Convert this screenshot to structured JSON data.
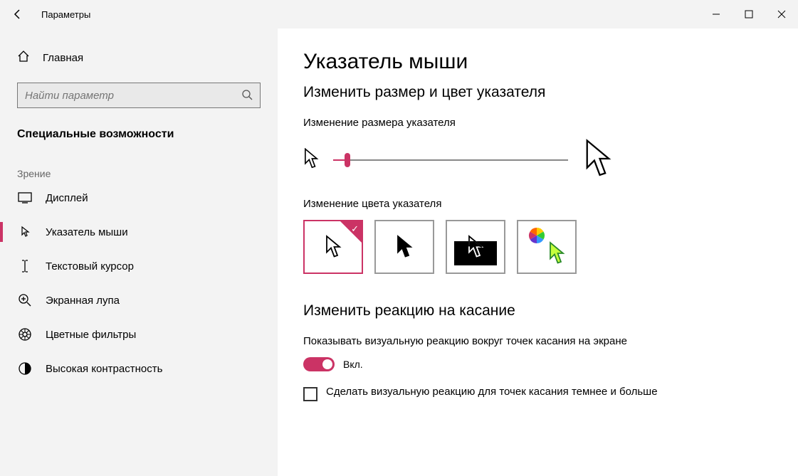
{
  "titlebar": {
    "title": "Параметры"
  },
  "sidebar": {
    "home": "Главная",
    "search_placeholder": "Найти параметр",
    "category": "Специальные возможности",
    "group_vision": "Зрение",
    "items": [
      {
        "icon": "display-icon",
        "label": "Дисплей"
      },
      {
        "icon": "pointer-icon",
        "label": "Указатель мыши",
        "active": true
      },
      {
        "icon": "text-cursor-icon",
        "label": "Текстовый курсор"
      },
      {
        "icon": "magnifier-icon",
        "label": "Экранная лупа"
      },
      {
        "icon": "color-filters-icon",
        "label": "Цветные фильтры"
      },
      {
        "icon": "contrast-icon",
        "label": "Высокая контрастность"
      }
    ]
  },
  "main": {
    "title": "Указатель мыши",
    "section_size_color": "Изменить размер и цвет указателя",
    "size_label": "Изменение размера указателя",
    "color_label": "Изменение цвета указателя",
    "section_touch": "Изменить реакцию на касание",
    "touch_desc": "Показывать визуальную реакцию вокруг точек касания на экране",
    "toggle_state": "Вкл.",
    "checkbox_label": "Сделать визуальную реакцию для точек касания темнее и больше"
  },
  "colors": {
    "accent": "#cb3365"
  }
}
